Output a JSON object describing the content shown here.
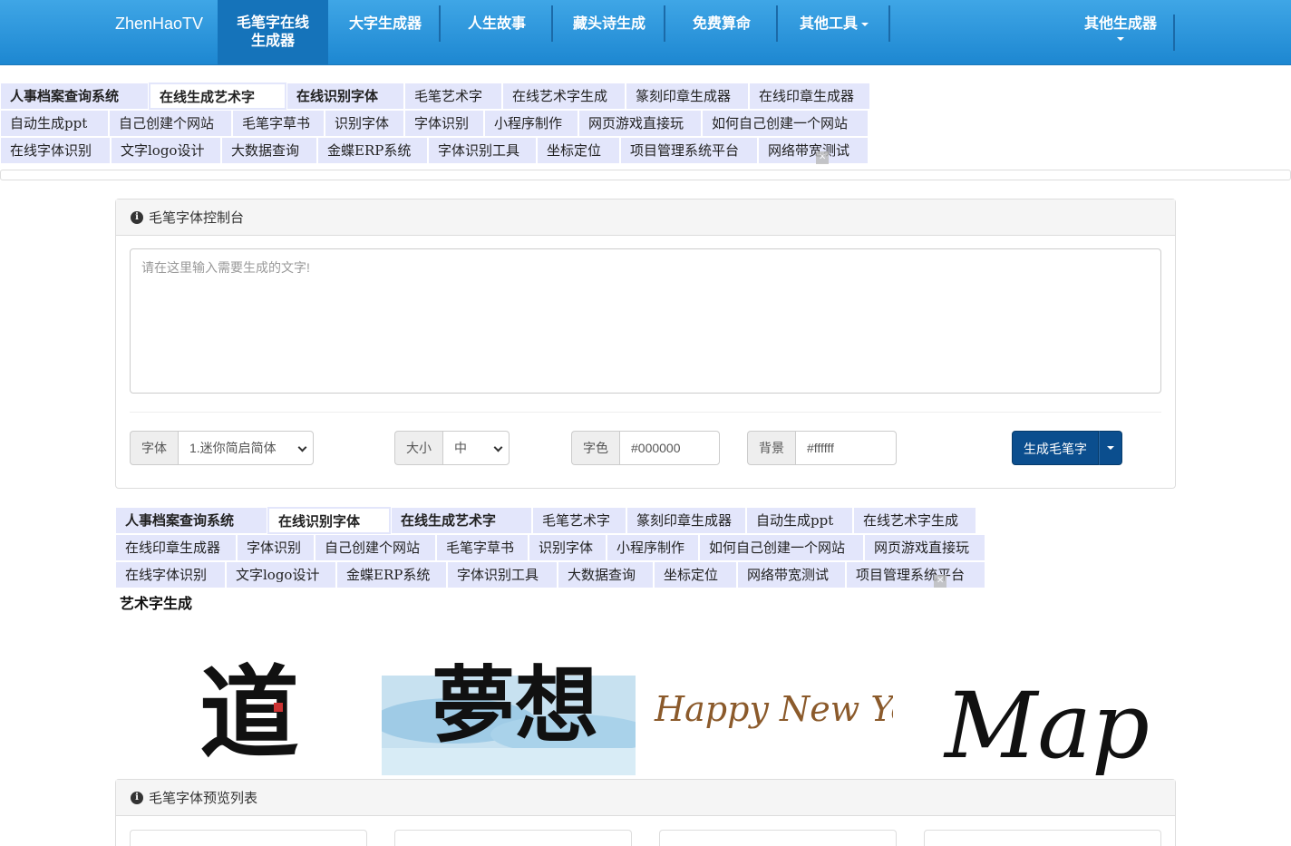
{
  "navbar": {
    "brand": "ZhenHaoTV",
    "items": [
      {
        "label": "毛笔字在线生成器",
        "line1": "毛笔字在线",
        "line2": "生成器",
        "active": true
      },
      {
        "label": "大字生成器"
      },
      {
        "label": "人生故事"
      },
      {
        "label": "藏头诗生成"
      },
      {
        "label": "免费算命"
      },
      {
        "label": "其他工具"
      }
    ],
    "right_item": "其他生成器"
  },
  "top_links": {
    "rows": [
      [
        "人事档案查询系统",
        "在线生成艺术字",
        "在线识别字体",
        "毛笔艺术字",
        "在线艺术字生成",
        "篆刻印章生成器",
        "在线印章生成器"
      ],
      [
        "自动生成ppt",
        "自己创建个网站",
        "毛笔字草书",
        "识别字体",
        "字体识别",
        "小程序制作",
        "网页游戏直接玩",
        "如何自己创建一个网站"
      ],
      [
        "在线字体识别",
        "文字logo设计",
        "大数据查询",
        "金蝶ERP系统",
        "字体识别工具",
        "坐标定位",
        "项目管理系统平台",
        "网络带宽测试"
      ]
    ]
  },
  "console": {
    "title": "毛笔字体控制台",
    "textarea_placeholder": "请在这里输入需要生成的文字!",
    "font_label": "字体",
    "font_value": "1.迷你简启简体",
    "size_label": "大小",
    "size_value": "中",
    "color_label": "字色",
    "color_value": "#000000",
    "bg_label": "背景",
    "bg_value": "#ffffff",
    "generate_button": "生成毛笔字"
  },
  "bottom_links": {
    "rows": [
      [
        "人事档案查询系统",
        "在线识别字体",
        "在线生成艺术字",
        "毛笔艺术字",
        "篆刻印章生成器",
        "自动生成ppt",
        "在线艺术字生成"
      ],
      [
        "在线印章生成器",
        "字体识别",
        "自己创建个网站",
        "毛笔字草书",
        "识别字体",
        "小程序制作",
        "如何自己创建一个网站",
        "网页游戏直接玩"
      ],
      [
        "在线字体识别",
        "文字logo设计",
        "金蝶ERP系统",
        "字体识别工具",
        "大数据查询",
        "坐标定位",
        "网络带宽测试",
        "项目管理系统平台"
      ]
    ]
  },
  "art_section": {
    "title": "艺术字生成",
    "samples": [
      {
        "text": "道"
      },
      {
        "text": "夢想"
      },
      {
        "text": "Happy New Year"
      },
      {
        "text": "Март"
      }
    ]
  },
  "preview": {
    "title": "毛笔字体预览列表"
  },
  "colors": {
    "navbar": "#1d87d1",
    "link_bg": "#e3e6fb",
    "button": "#0b4e8e"
  }
}
